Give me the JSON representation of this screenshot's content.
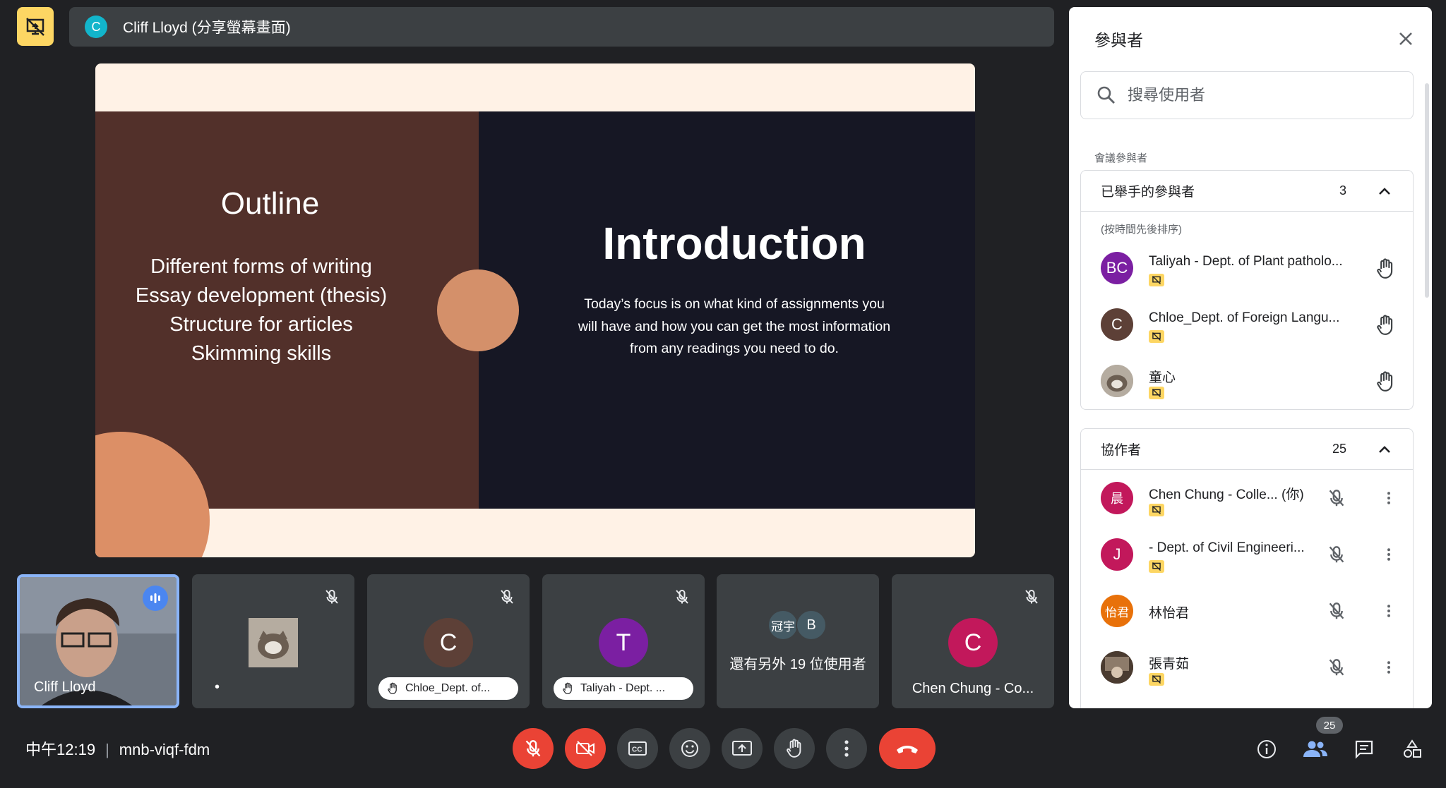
{
  "presenter_banner": {
    "avatar_letter": "C",
    "text": "Cliff Lloyd (分享螢幕畫面)"
  },
  "slide": {
    "outline_title": "Outline",
    "outline_items": [
      "Different forms of writing",
      "Essay development (thesis)",
      "Structure for articles",
      "Skimming skills"
    ],
    "intro_title": "Introduction",
    "intro_body": "Today’s focus is on what kind of assignments you will have and how you can get the most information from any readings you need to do."
  },
  "tiles": {
    "cliff": {
      "name": "Cliff Lloyd"
    },
    "guest_dot": "•",
    "chloe": {
      "letter": "C",
      "label": "Chloe_Dept. of..."
    },
    "taliyah": {
      "letter": "T",
      "label": "Taliyah - Dept. ..."
    },
    "others": {
      "av1": "冠宇",
      "av2": "B",
      "label": "還有另外 19 位使用者"
    },
    "chen": {
      "letter": "C",
      "name": "Chen Chung - Co..."
    }
  },
  "bottom": {
    "time": "中午12:19",
    "sep": "|",
    "meeting_code": "mnb-viqf-fdm",
    "participants_count": "25"
  },
  "panel": {
    "title": "參與者",
    "search_placeholder": "搜尋使用者",
    "section_label": "會議參與者",
    "raised": {
      "label": "已舉手的參與者",
      "count": "3",
      "sub": "(按時間先後排序)",
      "people": [
        {
          "avatar": "BC",
          "name": "Taliyah - Dept. of Plant patholo..."
        },
        {
          "avatar": "C",
          "name": "Chloe_Dept. of Foreign Langu..."
        },
        {
          "avatar": "",
          "name": "童心"
        }
      ]
    },
    "collab": {
      "label": "協作者",
      "count": "25",
      "people": [
        {
          "avatar": "晨",
          "name": "Chen Chung - Colle... (你)"
        },
        {
          "avatar": "J",
          "name": "- Dept. of Civil Engineeri..."
        },
        {
          "avatar": "怡君",
          "name": "林怡君"
        },
        {
          "avatar": "",
          "name": "張青茹"
        }
      ]
    }
  },
  "colors": {
    "accent": "#8ab4f8",
    "danger": "#ea4335",
    "present": "#fdd663",
    "purple": "#7b1fa2",
    "brown": "#5d4037",
    "crimson": "#c2185b",
    "orange": "#e8710a"
  },
  "icons": [
    "present-off-icon",
    "mic-off-icon",
    "speaking-icon",
    "hand-icon",
    "camera-off-icon",
    "captions-icon",
    "emoji-icon",
    "present-icon",
    "more-icon",
    "end-call-icon",
    "info-icon",
    "people-icon",
    "chat-icon",
    "activities-icon",
    "search-icon",
    "close-icon",
    "chevron-up-icon"
  ]
}
